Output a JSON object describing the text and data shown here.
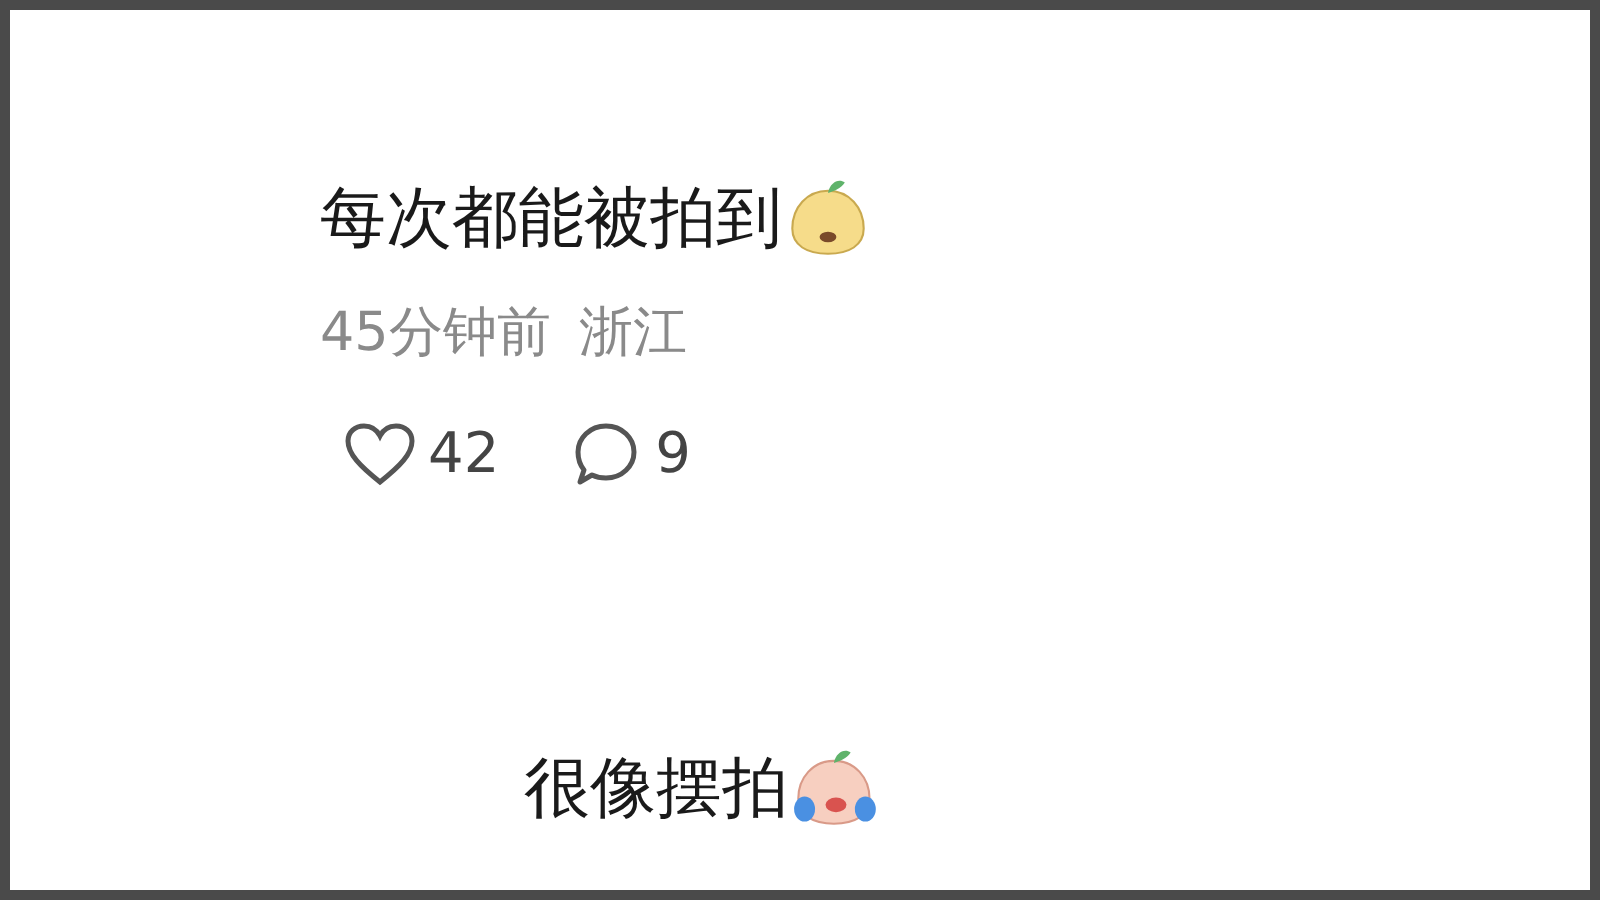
{
  "post": {
    "text": "每次都能被拍到",
    "emoji": {
      "kind": "happy"
    },
    "time": "45分钟前",
    "location": "浙江",
    "likes": "42",
    "comments": "9"
  },
  "reply": {
    "text": "很像摆拍",
    "emoji": {
      "kind": "crying"
    }
  }
}
